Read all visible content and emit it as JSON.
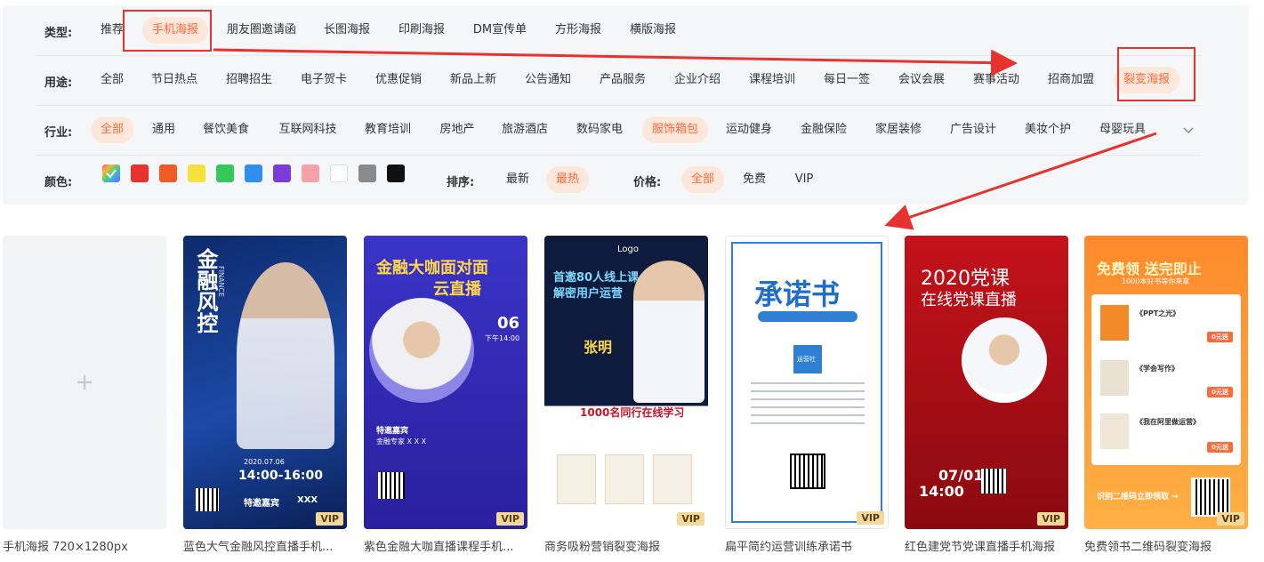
{
  "filters": {
    "type": {
      "label": "类型:",
      "options": [
        "推荐",
        "手机海报",
        "朋友圈邀请函",
        "长图海报",
        "印刷海报",
        "DM宣传单",
        "方形海报",
        "横版海报"
      ],
      "active": "手机海报"
    },
    "usage": {
      "label": "用途:",
      "options": [
        "全部",
        "节日热点",
        "招聘招生",
        "电子贺卡",
        "优惠促销",
        "新品上新",
        "公告通知",
        "产品服务",
        "企业介绍",
        "课程培训",
        "每日一签",
        "会议会展",
        "赛事活动",
        "招商加盟",
        "裂变海报"
      ],
      "active": "裂变海报"
    },
    "industry": {
      "label": "行业:",
      "options": [
        "全部",
        "通用",
        "餐饮美食",
        "互联网科技",
        "教育培训",
        "房地产",
        "旅游酒店",
        "数码家电",
        "服饰箱包",
        "运动健身",
        "金融保险",
        "家居装修",
        "广告设计",
        "美妆个护",
        "母婴玩具"
      ],
      "active": [
        "全部",
        "服饰箱包"
      ]
    },
    "color": {
      "label": "颜色:",
      "swatches": [
        "#ff6b6b",
        "#e8322e",
        "#f05a24",
        "#f7e03a",
        "#35c75a",
        "#2d8fef",
        "#7a3bd8",
        "#f6a1a6",
        "#ffffff",
        "#8a8a8a",
        "#111111"
      ]
    },
    "sort": {
      "label": "排序:",
      "options": [
        "最新",
        "最热"
      ],
      "active": "最热"
    },
    "price": {
      "label": "价格:",
      "options": [
        "全部",
        "免费",
        "VIP"
      ],
      "active": "全部"
    }
  },
  "accent_color": "#ff6a3a",
  "cards": [
    {
      "title": "手机海报 720×1280px",
      "vip": ""
    },
    {
      "title": "蓝色大气金融风控直播手机...",
      "vip": "VIP",
      "poster": [
        "金融风控",
        "FINANCE",
        "2020.07.06",
        "14:00-16:00",
        "特邀嘉宾",
        "XXX"
      ]
    },
    {
      "title": "紫色金融大咖直播课程手机...",
      "vip": "VIP",
      "poster": [
        "金融大咖面对面",
        "云直播",
        "06",
        "下午14:00",
        "特邀嘉宾",
        "金融专家 X X X"
      ]
    },
    {
      "title": "商务吸粉营销裂变海报",
      "vip": "VIP",
      "poster": [
        "Logo",
        "首邀80人线上课",
        "解密用户运营",
        "张明",
        "1000名同行在线学习"
      ]
    },
    {
      "title": "扁平简约运营训练承诺书",
      "vip": "VIP",
      "poster": [
        "承诺书",
        "运营社"
      ]
    },
    {
      "title": "红色建党节党课直播手机海报",
      "vip": "VIP",
      "poster": [
        "2020党课",
        "在线党课直播",
        "07/01",
        "14:00"
      ]
    },
    {
      "title": "免费领书二维码裂变海报",
      "vip": "VIP",
      "poster": [
        "免费领 送完即止",
        "1000本好书等你来拿",
        "《PPT之光》",
        "《学会写作》",
        "《我在阿里做运营》",
        "0元送",
        "识别二维码立即领取 →"
      ]
    }
  ],
  "plus_symbol": "+"
}
